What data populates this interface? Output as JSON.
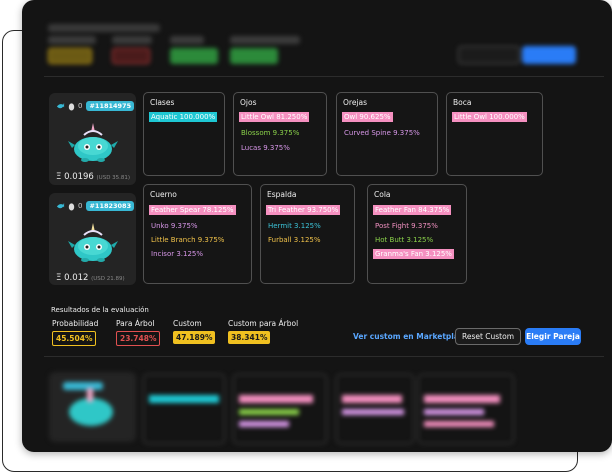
{
  "axies": [
    {
      "zero": "0",
      "id": "#11814975",
      "eth": "0.0196",
      "usd": "(USD 35.81)"
    },
    {
      "zero": "0",
      "id": "#11823083",
      "eth": "0.012",
      "usd": "(USD 21.89)"
    }
  ],
  "parts": {
    "clases": {
      "title": "Clases",
      "items": [
        {
          "text": "Aquatic 100.000%",
          "color": "#ffffff",
          "highlight": "teal"
        }
      ]
    },
    "ojos": {
      "title": "Ojos",
      "items": [
        {
          "text": "Little Owl 81.250%",
          "color": "#ffffff",
          "highlight": "pink"
        },
        {
          "text": "Blossom 9.375%",
          "color": "#8ad14a"
        },
        {
          "text": "Lucas 9.375%",
          "color": "#d797e8"
        }
      ]
    },
    "orejas": {
      "title": "Orejas",
      "items": [
        {
          "text": "Owl 90.625%",
          "color": "#ffffff",
          "highlight": "pink"
        },
        {
          "text": "Curved Spine 9.375%",
          "color": "#d797e8"
        }
      ]
    },
    "boca": {
      "title": "Boca",
      "items": [
        {
          "text": "Little Owl 100.000%",
          "color": "#ffffff",
          "highlight": "pink"
        }
      ]
    },
    "cuerno": {
      "title": "Cuerno",
      "items": [
        {
          "text": "Feather Spear 78.125%",
          "color": "#ffffff",
          "highlight": "pink"
        },
        {
          "text": "Unko 9.375%",
          "color": "#d797e8"
        },
        {
          "text": "Little Branch 9.375%",
          "color": "#f0c24a"
        },
        {
          "text": "Incisor 3.125%",
          "color": "#d797e8"
        }
      ]
    },
    "espalda": {
      "title": "Espalda",
      "items": [
        {
          "text": "Tri Feather 93.750%",
          "color": "#ffffff",
          "highlight": "pink"
        },
        {
          "text": "Hermit 3.125%",
          "color": "#3cc3d8"
        },
        {
          "text": "Furball 3.125%",
          "color": "#f0c24a"
        }
      ]
    },
    "cola": {
      "title": "Cola",
      "items": [
        {
          "text": "Feather Fan 84.375%",
          "color": "#ffffff",
          "highlight": "pink"
        },
        {
          "text": "Post Fight 9.375%",
          "color": "#f090c0"
        },
        {
          "text": "Hot Butt 3.125%",
          "color": "#8ad14a"
        },
        {
          "text": "Granma's Fan 3.125%",
          "color": "#ffffff",
          "highlight": "pink"
        }
      ]
    }
  },
  "results": {
    "title": "Resultados de la evaluación",
    "probabilidad": {
      "label": "Probabilidad",
      "value": "45.504%",
      "color": "#f0c020"
    },
    "para_arbol": {
      "label": "Para Árbol",
      "value": "23.748%",
      "color": "#e05050"
    },
    "custom": {
      "label": "Custom",
      "value": "47.189%",
      "color": "#f0c020"
    },
    "custom_arbol": {
      "label": "Custom para Árbol",
      "value": "38.341%",
      "color": "#f0c020"
    }
  },
  "actions": {
    "marketplace": "Ver custom en Marketplace",
    "reset": "Reset Custom",
    "choose": "Elegir Pareja"
  }
}
